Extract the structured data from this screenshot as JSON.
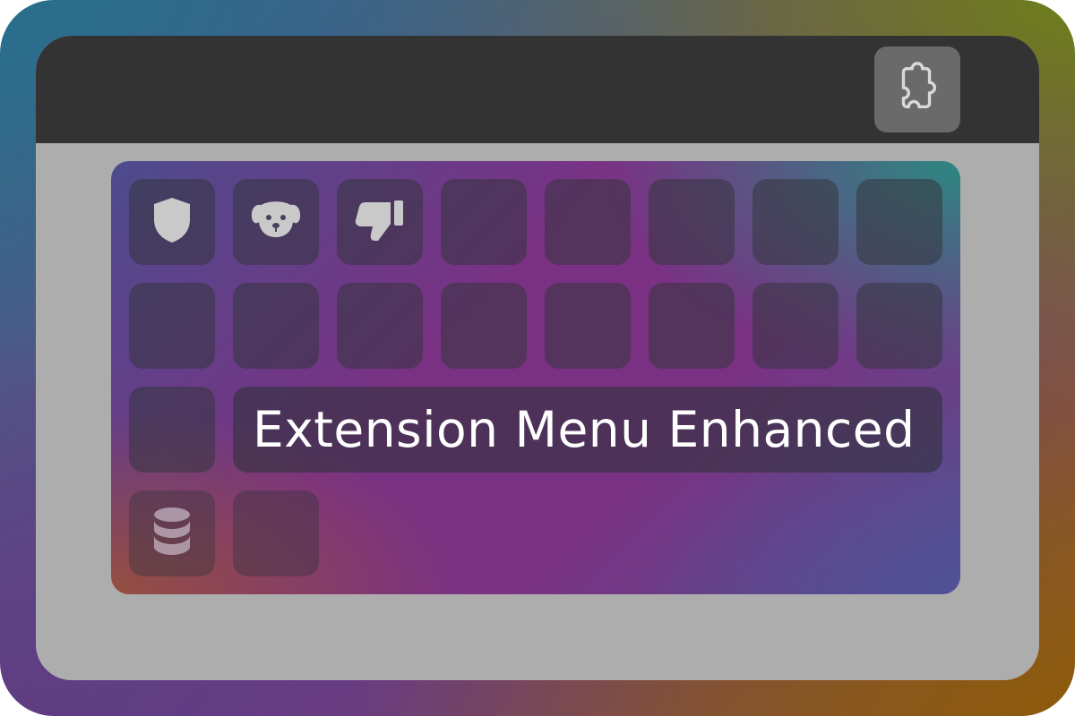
{
  "toolbar": {
    "extensions_button": {
      "icon": "puzzle-icon"
    }
  },
  "popup": {
    "tiles_row1": [
      {
        "icon": "shield-icon"
      },
      {
        "icon": "dog-icon"
      },
      {
        "icon": "thumbs-down-icon"
      },
      {
        "icon": ""
      },
      {
        "icon": ""
      },
      {
        "icon": ""
      },
      {
        "icon": ""
      },
      {
        "icon": ""
      }
    ],
    "tiles_row2": [
      {
        "icon": ""
      },
      {
        "icon": ""
      },
      {
        "icon": ""
      },
      {
        "icon": ""
      },
      {
        "icon": ""
      },
      {
        "icon": ""
      },
      {
        "icon": ""
      },
      {
        "icon": ""
      }
    ],
    "tiles_row3": [
      {
        "icon": ""
      }
    ],
    "tiles_row4": [
      {
        "icon": "database-icon"
      },
      {
        "icon": ""
      }
    ],
    "tooltip": {
      "text": "Extension Menu Enhanced"
    }
  },
  "colors": {
    "toolbar": "#333333",
    "window": "#adadad",
    "extension_button": "#6a6a6a",
    "icon": "#c8c8c8"
  }
}
